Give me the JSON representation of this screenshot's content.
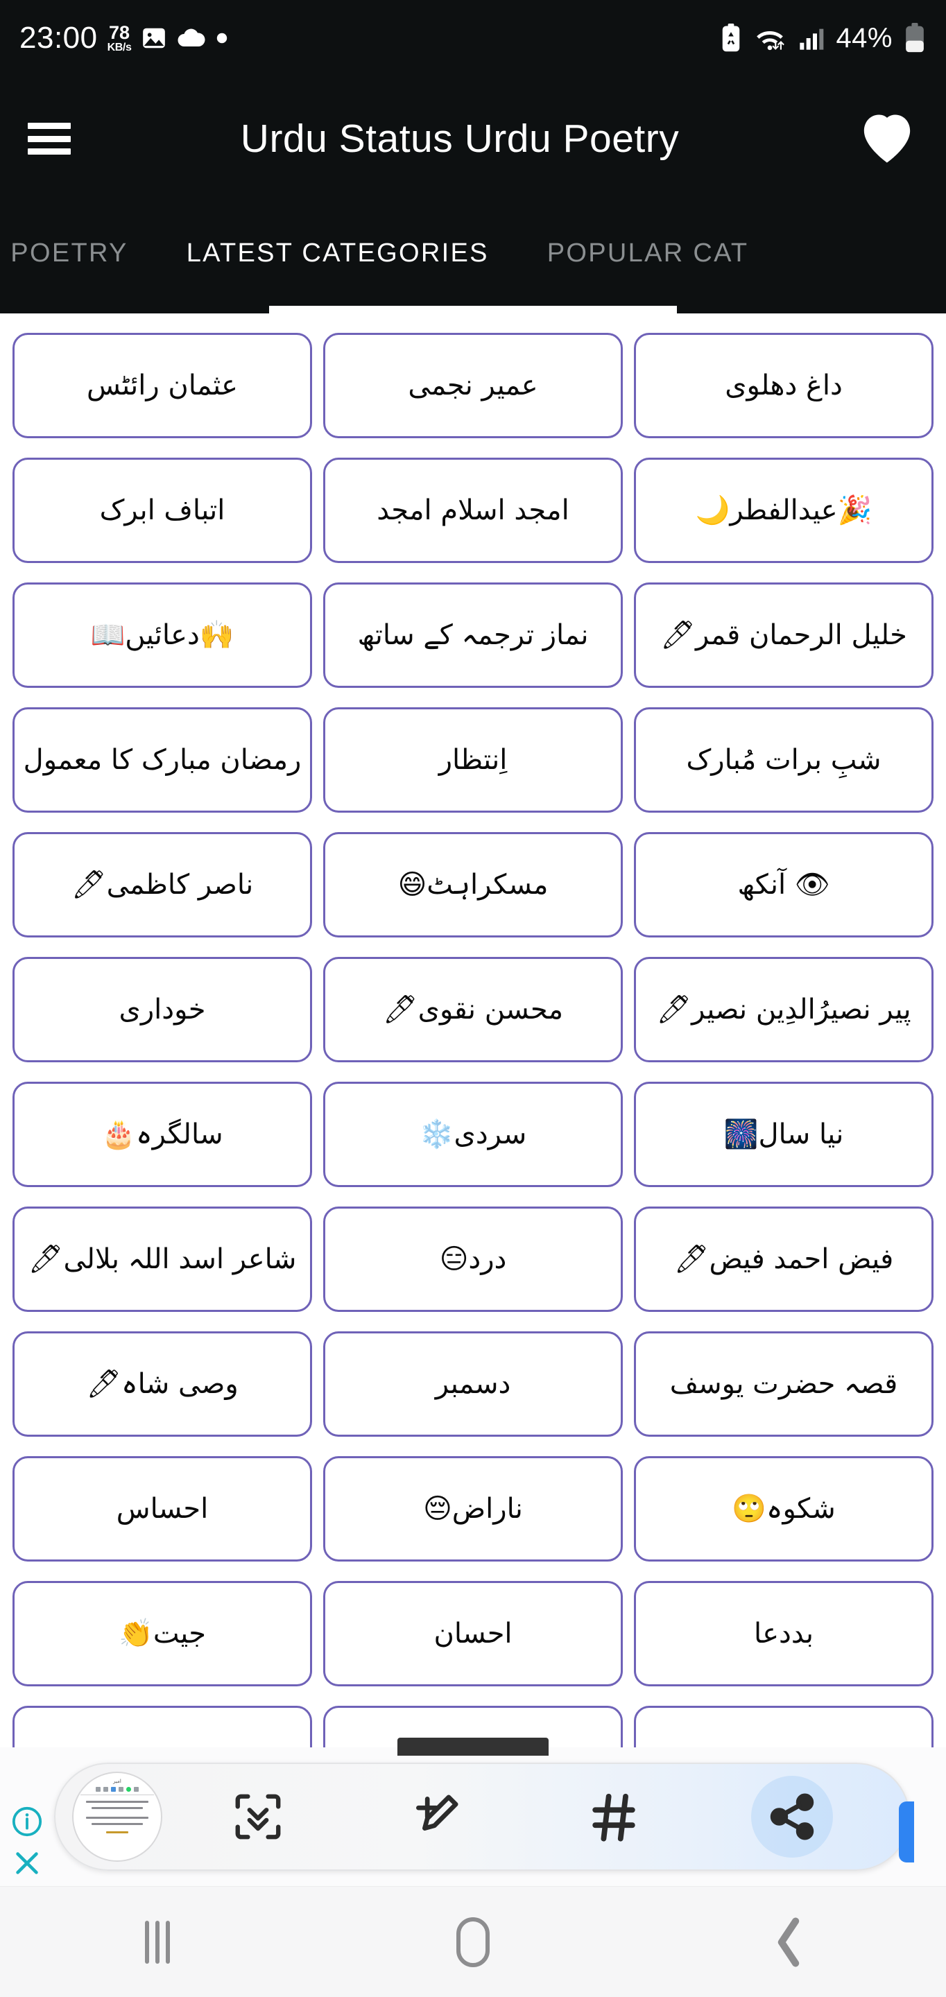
{
  "status_bar": {
    "clock": "23:00",
    "network_speed_value": "78",
    "network_speed_unit": "KB/s",
    "icons_left": [
      "image-icon",
      "cloud-icon",
      "dot-icon"
    ],
    "icons_right": [
      "battery-saver-icon",
      "wifi-icon",
      "signal-icon"
    ],
    "battery_percent": "44%"
  },
  "app_bar": {
    "menu_icon": "hamburger-menu-icon",
    "title": "Urdu Status Urdu Poetry",
    "favorite_icon": "heart-icon"
  },
  "tabs": {
    "items": [
      {
        "label": "ATEST POETRY",
        "active": false
      },
      {
        "label": "LATEST CATEGORIES",
        "active": true
      },
      {
        "label": "POPULAR CAT",
        "active": false
      }
    ],
    "active_index": 1,
    "indicator_color": "#ffffff"
  },
  "grid": {
    "border_color": "#6f62b8",
    "card_background": "#ffffff",
    "text_color": "#0a0a0a",
    "columns": 3,
    "items": [
      {
        "label": "داغ دھلوی"
      },
      {
        "label": "عمیر نجمی"
      },
      {
        "label": "عثمان رائٹس"
      },
      {
        "label": "🎉عیدالفطر🌙"
      },
      {
        "label": "امجد اسلام امجد"
      },
      {
        "label": "اتباف ابرک"
      },
      {
        "label": "خلیل الرحمان قمر🖊"
      },
      {
        "label": "نماز ترجمہ کے ساتھ"
      },
      {
        "label": "🙌دعائیں📖"
      },
      {
        "label": "شبِ برات مُبارک"
      },
      {
        "label": "اِنتظار"
      },
      {
        "label": "رمضان مبارک کا معمول"
      },
      {
        "label": "👁 آنکھ"
      },
      {
        "label": "مسکراہٹ😄"
      },
      {
        "label": "ناصر کاظمی🖊"
      },
      {
        "label": "پیر نصیرُالدِین نصیر🖊"
      },
      {
        "label": "محسن نقوی🖊"
      },
      {
        "label": "خوداری"
      },
      {
        "label": "نیا سال🎆"
      },
      {
        "label": "سردی❄️"
      },
      {
        "label": "سالگرہ🎂"
      },
      {
        "label": "فیض احمد فیض🖊"
      },
      {
        "label": "درد😑"
      },
      {
        "label": "شاعر اسد اللہ بلالی🖊"
      },
      {
        "label": "قصہ حضرت یوسف"
      },
      {
        "label": "دسمبر"
      },
      {
        "label": "وصی شاہ🖊"
      },
      {
        "label": "شکوہ🙄"
      },
      {
        "label": "ناراض😔"
      },
      {
        "label": "احساس"
      },
      {
        "label": "بددعا"
      },
      {
        "label": "احسان"
      },
      {
        "label": "جیت👏"
      },
      {
        "label": ""
      },
      {
        "label": ""
      },
      {
        "label": ""
      }
    ]
  },
  "ad_bar": {
    "thumbnail_name": "poetry-card-thumbnail",
    "actions": [
      {
        "icon": "scan-frame-icon",
        "highlighted": false
      },
      {
        "icon": "add-edit-pencil-icon",
        "highlighted": false
      },
      {
        "icon": "hashtag-icon",
        "highlighted": false
      },
      {
        "icon": "share-icon",
        "highlighted": true
      }
    ],
    "info_icon": "info-icon",
    "close_icon": "close-icon",
    "accent_color": "#2f84f2",
    "highlight_color": "#dbeafd"
  },
  "nav_bar": {
    "recents_icon": "recents-icon",
    "home_icon": "home-icon",
    "back_icon": "back-icon"
  }
}
